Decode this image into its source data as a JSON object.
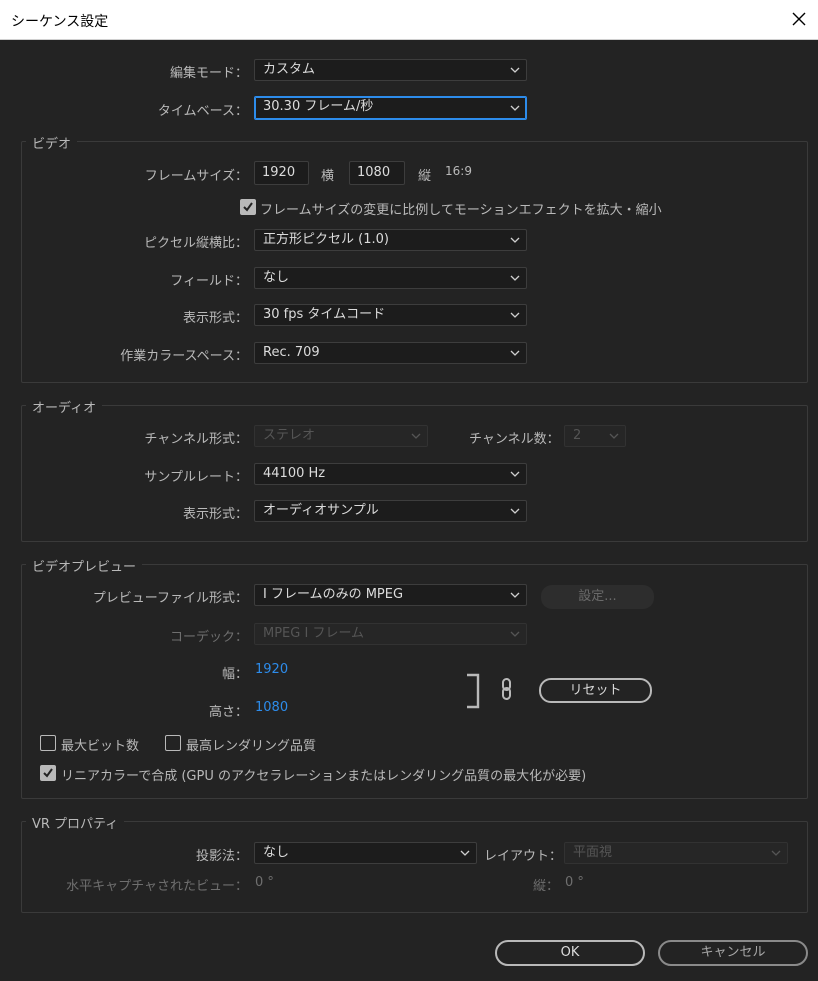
{
  "window": {
    "title": "シーケンス設定"
  },
  "top": {
    "edit_mode_label": "編集モード：",
    "edit_mode_value": "カスタム",
    "timebase_label": "タイムベース：",
    "timebase_value": "30.30  フレーム/秒"
  },
  "video": {
    "group_title": "ビデオ",
    "frame_size_label": "フレームサイズ：",
    "frame_width": "1920",
    "width_unit": "横",
    "frame_height": "1080",
    "height_unit": "縦",
    "aspect": "16:9",
    "scale_checkbox_label": "フレームサイズの変更に比例してモーションエフェクトを拡大・縮小",
    "scale_checked": true,
    "pixel_aspect_label": "ピクセル縦横比：",
    "pixel_aspect_value": "正方形ピクセル (1.0)",
    "fields_label": "フィールド：",
    "fields_value": "なし",
    "display_format_label": "表示形式：",
    "display_format_value": "30 fps タイムコード",
    "color_space_label": "作業カラースペース：",
    "color_space_value": "Rec. 709"
  },
  "audio": {
    "group_title": "オーディオ",
    "channel_format_label": "チャンネル形式：",
    "channel_format_value": "ステレオ",
    "channel_count_label": "チャンネル数：",
    "channel_count_value": "2",
    "sample_rate_label": "サンプルレート：",
    "sample_rate_value": "44100 Hz",
    "display_format_label": "表示形式：",
    "display_format_value": "オーディオサンプル"
  },
  "preview": {
    "group_title": "ビデオプレビュー",
    "file_format_label": "プレビューファイル形式：",
    "file_format_value": "I フレームのみの MPEG",
    "settings_button": "設定...",
    "codec_label": "コーデック：",
    "codec_value": "MPEG I フレーム",
    "width_label": "幅：",
    "width_value": "1920",
    "height_label": "高さ：",
    "height_value": "1080",
    "reset_button": "リセット",
    "max_bit_depth_label": "最大ビット数",
    "max_bit_depth_checked": false,
    "max_render_quality_label": "最高レンダリング品質",
    "max_render_quality_checked": false,
    "linear_color_label": "リニアカラーで合成 (GPU のアクセラレーションまたはレンダリング品質の最大化が必要)",
    "linear_color_checked": true
  },
  "vr": {
    "group_title": "VR プロパティ",
    "projection_label": "投影法：",
    "projection_value": "なし",
    "layout_label": "レイアウト：",
    "layout_value": "平面視",
    "h_captured_label": "水平キャプチャされたビュー：",
    "h_captured_value": "0 °",
    "vertical_label": "縦：",
    "vertical_value": "0 °"
  },
  "footer": {
    "ok": "OK",
    "cancel": "キャンセル"
  }
}
